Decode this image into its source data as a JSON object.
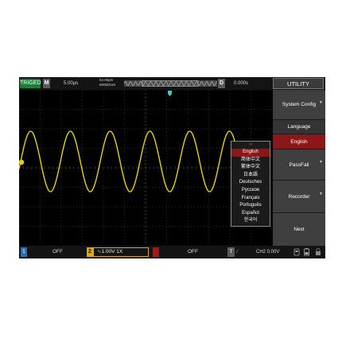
{
  "topbar": {
    "trig_status": "TRIGED",
    "mode": "M",
    "timebase": "5.00µs",
    "memory_depth": "64.0kpts",
    "sample_rate": "500MSa/s",
    "d_label": "D",
    "h_position": "0.000s",
    "menu_title": "UTILITY"
  },
  "menu": {
    "items": [
      {
        "label": "System Config",
        "has_more": true
      },
      {
        "label": "Language",
        "has_more": false
      },
      {
        "label": "English",
        "has_more": false
      },
      {
        "label": "PassFail",
        "has_more": true
      },
      {
        "label": "Recorder",
        "has_more": true
      },
      {
        "label": "Next",
        "has_more": false
      }
    ]
  },
  "language_list": {
    "top_glyph": "○",
    "options": [
      "English",
      "简体中文",
      "繁体中文",
      "日本語",
      "Deutsches",
      "Русское",
      "Français",
      "Português",
      "Español",
      "한국어"
    ],
    "selected": "English"
  },
  "bottombar": {
    "ch1_num": "1",
    "ch1_state": "OFF",
    "ch2_num": "2",
    "ch2_value": "1.00V  1X",
    "ch3_state": "OFF",
    "trigger_btn": "T",
    "slope_glyph": "∕",
    "trigger_info": "CH2 0.00V"
  },
  "colors": {
    "waveform": "#e8d200",
    "grid": "#5a5a5a",
    "trigger_marker": "#2fd6c6",
    "menu_selected": "#8a1818",
    "ch1": "#2a6fb0",
    "ch2": "#e0a800",
    "ch3": "#a01818"
  },
  "icons": [
    "trigger-marker-icon",
    "ch1-level-marker-icon",
    "usb-icon",
    "battery-icon",
    "lock-icon"
  ]
}
